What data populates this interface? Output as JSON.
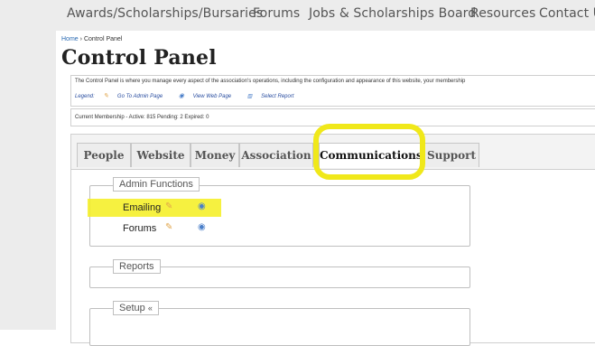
{
  "topnav": {
    "items": [
      "Awards/Scholarships/Bursaries",
      "Forums",
      "Jobs & Scholarships Board",
      "Resources",
      "Contact U"
    ]
  },
  "breadcrumb": {
    "home": "Home",
    "separator": "›",
    "current": "Control Panel"
  },
  "page_title": "Control Panel",
  "description": "The Control Panel is where you manage every aspect of the association's operations, including the configuration and appearance of this website, your membership",
  "legend": {
    "label": "Legend:",
    "items": [
      "Go To Admin Page",
      "View Web Page",
      "Select Report"
    ]
  },
  "membership": "Current Membership - Active: 815   Pending: 2   Expired: 0",
  "tabs": [
    {
      "label": "People"
    },
    {
      "label": "Website"
    },
    {
      "label": "Money"
    },
    {
      "label": "Association"
    },
    {
      "label": "Communications",
      "active": true
    },
    {
      "label": "Support"
    }
  ],
  "sections": {
    "admin": {
      "title": "Admin Functions",
      "rows": [
        "Emailing",
        "Forums"
      ]
    },
    "reports": {
      "title": "Reports"
    },
    "setup": {
      "title": "Setup",
      "toggle": "«"
    }
  },
  "colors": {
    "highlight": "#f4ef1e",
    "link": "#2a6ab3",
    "legend_text": "#2a4ea0"
  }
}
